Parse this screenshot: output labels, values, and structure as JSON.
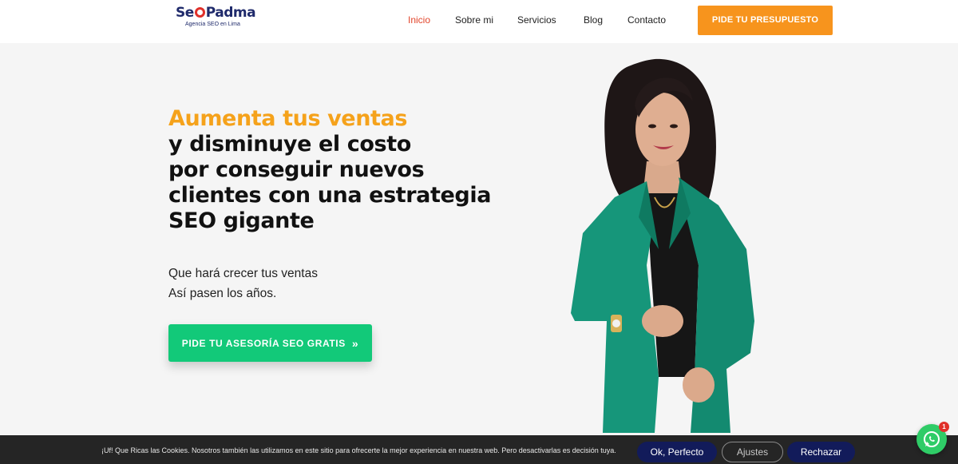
{
  "header": {
    "logo": {
      "text_pre": "Se",
      "text_post": "Padma",
      "tagline": "Agencia SEO en Lima"
    },
    "nav": [
      {
        "label": "Inicio",
        "active": true
      },
      {
        "label": "Sobre mi",
        "active": false
      },
      {
        "label": "Servicios",
        "active": false
      },
      {
        "label": "Blog",
        "active": false
      },
      {
        "label": "Contacto",
        "active": false
      }
    ],
    "cta": "PIDE TU PRESUPUESTO"
  },
  "hero": {
    "headline_accent": "Aumenta tus ventas",
    "headline_lines": [
      "y disminuye el costo",
      "por conseguir nuevos",
      "clientes con una estrategia",
      "SEO gigante"
    ],
    "sub_lines": [
      "Que hará crecer tus ventas",
      "Así pasen los años."
    ],
    "cta": "PIDE TU ASESORÍA SEO GRATIS",
    "cta_icon": "double-chevron-right-icon"
  },
  "cookie_bar": {
    "text": "¡Uf! Que Ricas las Cookies. Nosotros también las utilizamos en este sitio para ofrecerte la mejor experiencia en nuestra web. Pero desactivarlas es decisión tuya.",
    "accept": "Ok, Perfecto",
    "settings": "Ajustes",
    "reject": "Rechazar"
  },
  "whatsapp": {
    "icon": "whatsapp-icon",
    "badge": "1"
  },
  "colors": {
    "accent_orange": "#f7941d",
    "headline_yellow": "#f5a21b",
    "cta_green": "#12c979",
    "active_nav": "#e2452b",
    "cookie_button_navy": "#121b5a",
    "whatsapp_green": "#2fcc67"
  }
}
